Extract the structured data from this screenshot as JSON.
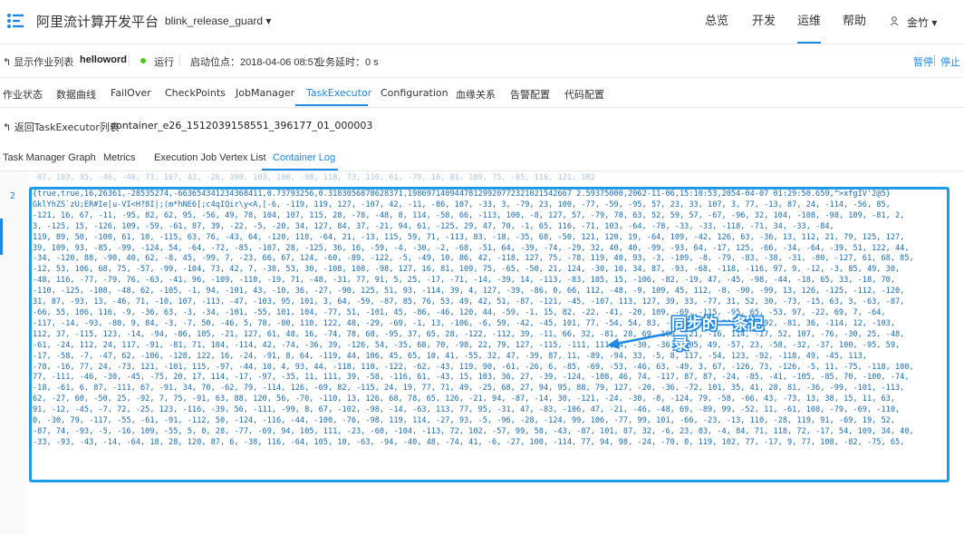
{
  "header": {
    "brand": "阿里流计算开发平台",
    "project": "blink_release_guard ▾",
    "nav": [
      "总览",
      "开发",
      "运维",
      "帮助"
    ],
    "active_nav": "运维",
    "user_icon": "user-icon",
    "user": "金竹 ▾",
    "accent": "#1e88e5"
  },
  "jobbar": {
    "back": "↰ 显示作业列表",
    "job_name": "helloword",
    "status": "运行",
    "status_color": "#52c41a",
    "start_pos": "启动位点：2018-04-06 08:57",
    "delay": "业务延时：0 s",
    "pause": "暂停",
    "stop": "停止"
  },
  "tabs1": [
    "作业状态",
    "数据曲线",
    "FailOver",
    "CheckPoints",
    "JobManager",
    "TaskExecutor",
    "Configuration",
    "血缘关系",
    "告警配置",
    "代码配置"
  ],
  "tabs1_active": "TaskExecutor",
  "breadcrumb": {
    "back": "↰ 返回TaskExecutor列表",
    "divider": "/",
    "container": "container_e26_1512039158551_396177_01_000003"
  },
  "tabs2": [
    "Task Manager Graph",
    "Metrics",
    "Execution Job Vertex List",
    "Container Log"
  ],
  "tabs2_active": "Container Log",
  "log": {
    "line_number": "2",
    "faded_top": "-87, 103, 95, -46, -40, 71, 107, 43, -26, 108, 103, 100, -98, 118, 73, 110, 61, -79, 16, 81, 109, 75, -85, 116, 121, 102",
    "lines": [
      "{true,true,16,26361,-28535274,-663654341234368411,0.73793256,0.3183056878628371,19869714094478129920772321021542667 2.59375000,2062-11-06,15:10:53,2054-04-07 01:29:50.659,^>xfgIV'2@5}",
      "GklYhZS`zU;ER#Ie[u-VI<H?8I|;(m*hNE6[;c4qIQir\\y<A,[-6, -119, 119, 127, -107, 42, -11, -86, 107, -33, 3, -79, 23, 100, -77, -59, -95, 57, 23, 33, 107, 3, 77, -13, 87, 24, -114, -56, 85,",
      "-121, 16, 67, -11, -95, 82, 62, 95, -56, 49, 78, 104, 107, 115, 28, -78, -48, 8, 114, -58, 66, -113, 100, -8, 127, 57, -79, 78, 63, 52, 59, 57, -67, -96, 32, 104, -108, -98, 109, -81, 2,",
      "3, -125, 15, -126, 109, -59, -61, 87, 39, -22, -5, -20, 34, 127, 84, 37, -21, 94, 61, -125, 29, 47, 70, -1, 65, 116, -71, 103, -64, -78, -33, -33, -118, -71, 34, -33, -84,",
      "119, 89, 50, -100, 61, 10, -115, 63, 76, -43, 64, -120, 118, -64, 21, -13, 115, 59, 71, -113, 83, -18, -35, 68, -50, 121, 120, 19, -64, 109, -42, 126, 63, -36, 13, 112, 21, 79, 125, 127,",
      "39, 109, 93, -85, -99, -124, 54, -64, -72, -85, -107, 28, -125, 36, 16, -59, -4, -30, -2, -68, -51, 64, -39, -74, -29, 32, 40, 40, -99, -93, 64, -17, 125, -66, -34, -64, -39, 51, 122, 44,",
      "-34, -120, 88, -90, 40, 62, -8, 45, -99, 7, -23, 66, 67, 124, -60, -89, -122, -5, -49, 10, 86, 42, -118, 127, 75, -78, 119, 40, 93, -3, -109, -8, -79, -83, -38, -31, -80, -127, 61, 68, 85,",
      "-12, 53, 106, 68, 75, -57, -99, -104, 73, 42, 7, -38, 53, 30, -108, 108, -98, 127, 16, 81, 109, 75, -65, -50, 21, 124, -30, 10, 34, 87, -93, -68, -118, -116, 97, 9, -12, -3, 85, 49, 30,",
      "-48, 116, -77, -79, 76, -63, -41, 96, -109, -110, -19, 71, -48, -31, 77, 91, 5, 25, -17, -71, -14, -39, 14, -113, -83, 105, 15, -106, -82, -19, 47, -45, -98, -44, -18, 65, 33, -18, 70,",
      "-110, -125, -108, -48, 62, -105, -1, 94, -101, 43, -10, 36, -27, -90, 125, 51, 93, -114, 39, 4, 127, -39, -86, 0, 66, 112, -48, -9, 109, 45, 112, -8, -90, -99, 13, 126, -125, -112, -120,",
      "31, 87, -93, 13, -46, 71, -10, 107, -113, -47, -103, 95, 101, 3, 64, -59, -87, 85, 76, 53, 49, 42, 51, -87, -121, -45, -107, 113, 127, 39, 33, -77, 31, 52, 30, -73, -15, 63, 3, -63, -87,",
      "-66, 55, 106, 116, -9, -36, 63, -3, -34, -101, -55, 101, 104, -77, 51, -101, 45, -86, -46, 120, 44, -59, -1, 15, 82, -22, -41, -20, 109, -69, -115, -95, 65, -53, 97, -22, 69, 7, -64,",
      "-117, -14, -93, -80, 9, 84, -3, -7, 50, -46, 5, 78, -80, 110, 122, 48, -29, -69, -1, 13, -106, -6, 59, -42, -45, 101, 77, -54, 54, 83, -112, -35, -90, -91, 92, -81, 36, -114, 12, -103,",
      "112, 37, -115, 123, -14, -94, -86, 105, -21, 127, 61, 48, 16, -74, 78, 68, -95, 37, 65, 28, -122, -112, 39, -11, 66, 32, -81, 28, 69, 100, -21, -16, 114, -17, 52, 107, -76, -30, 25, -48,",
      "-61, -24, 112, 24, 117, -91, -81, 71, 104, -114, 42, -74, -36, 39, -126, 54, -35, 68, 70, -98, 22, 79, 127, -115, -111, 111, 4, -30, -36, -105, 49, -57, 23, -58, -32, -37, 100, -95, 59,",
      "-17, -58, -7, -47, 62, -106, -128, 122, 16, -24, -91, 8, 64, -119, 44, 106, 45, 65, 10, 41, -55, 32, 47, -39, 87, 11, -89, -94, 33, -5, 8, 117, -54, 123, -92, -118, 49, -45, 113,",
      "-78, -16, 77, 24, -73, 121, -101, 115, -97, -44, 10, 4, 93, 44, -118, 110, -122, -62, -43, 119, 90, -61, -26, 6, -85, -69, -53, -46, 63, -49, 3, 67, -126, 73, -126, -5, 11, -75, -118, 100,",
      "77, -111, -46, -30, -45, -75, 20, 17, 114, -17, -97, -35, 11, 111, 39, -58, -116, 61, -43, 15, 103, 36, 27, -39, -124, -108, 46, 74, -117, 87, 87, -24, -85, -41, -105, -85, 70, -100, -74,",
      "-18, -61, 6, 87, -111, 67, -91, 34, 70, -62, 79, -114, 126, -69, 82, -115, 24, 19, 77, 71, 49, -25, 68, 27, 94, 95, 88, 79, 127, -20, -36, -72, 101, 35, 41, 28, 81, -36, -99, -101, -113,",
      "62, -27, 60, -50, 25, -92, 7, 75, -91, 63, 88, 120, 56, -70, -110, 13, 126, 68, 78, 65, 126, -21, 94, -87, -14, 30, -121, -24, -30, -8, -124, 79, -58, -66, 43, -73, 13, 38, 15, 11, 63,",
      "91, -12, -45, -7, 72, -25, 123, -116, -39, 56, -111, -99, 8, 67, -102, -98, -14, -63, 113, 77, 95, -31, 47, -83, -106, 47, -21, -46, -48, 69, -89, 99, -52, 11, -61, 108, -79, -69, -110,",
      "0, -30, 79, -117, -55, -61, -91, -112, 50, -124, -116, -44, -100, -76, -98, 119, 114, -27, 93, -5, -96, -28, -124, 99, 106, -77, 99, 101, -66, -23, -13, 110, -28, 119, 91, -69, 19, 52,",
      "-87, 74, -93, -5, -16, 109, -55, 5, 0, 28, -77, -69, 94, 105, 111, -23, -60, -104, -113, 72, 102, -57, 99, 58, -43, -87, 101, 87, 32, -6, 23, 83, -4, 84, 71, 118, 72, -17, 54, 109, 34, 40,",
      "-33, -93, -43, -14, -64, 18, 28, 120, 87, 6, -38, 116, -64, 105, 10, -63, -94, -40, 48, -74, 41, -6, -27, 100, -114, 77, 94, 98, -24, -70, 0, 119, 102, 77, -17, 9, 77, 108, -82, -75, 65,"
    ]
  },
  "annotation": {
    "line1": "同步的一条记",
    "line2": "录",
    "border_color": "#1e9be8"
  }
}
